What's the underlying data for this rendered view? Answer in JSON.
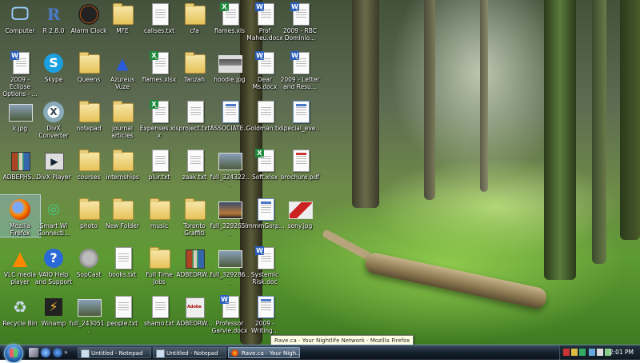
{
  "desktop": {
    "columns": [
      [
        {
          "label": "Computer",
          "icon": "computer-icon"
        },
        {
          "label": "2009 - Eclipse Options - ...",
          "icon": "word-doc-icon"
        },
        {
          "label": "k.jpg",
          "icon": "image-icon"
        },
        {
          "label": "ADBEPHS...",
          "icon": "archive-icon"
        },
        {
          "label": "Mozilla Firefox",
          "icon": "firefox-icon",
          "selected": true
        },
        {
          "label": "VLC media player",
          "icon": "vlc-icon"
        },
        {
          "label": "Recycle Bin",
          "icon": "recycle-bin-icon"
        }
      ],
      [
        {
          "label": "R 2.8.0",
          "icon": "r-icon"
        },
        {
          "label": "Skype",
          "icon": "skype-icon"
        },
        {
          "label": "DivX Converter",
          "icon": "divx-converter-icon"
        },
        {
          "label": "DivX Player",
          "icon": "divx-player-icon"
        },
        {
          "label": "Smart Wi Connecti...",
          "icon": "wifi-icon"
        },
        {
          "label": "VAIO Help and Support",
          "icon": "help-icon"
        },
        {
          "label": "Winamp",
          "icon": "winamp-icon"
        }
      ],
      [
        {
          "label": "Alarm Clock",
          "icon": "clock-icon"
        },
        {
          "label": "Queens",
          "icon": "folder-icon"
        },
        {
          "label": "notepad",
          "icon": "folder-icon"
        },
        {
          "label": "courses",
          "icon": "folder-icon"
        },
        {
          "label": "photo",
          "icon": "folder-icon"
        },
        {
          "label": "SopCast",
          "icon": "sopcast-icon"
        },
        {
          "label": "full_243051...",
          "icon": "image-icon"
        }
      ],
      [
        {
          "label": "MFE",
          "icon": "folder-icon"
        },
        {
          "label": "Azureus Vuze",
          "icon": "vuze-icon"
        },
        {
          "label": "journal articles",
          "icon": "folder-icon"
        },
        {
          "label": "internships",
          "icon": "folder-icon"
        },
        {
          "label": "New Folder",
          "icon": "folder-icon"
        },
        {
          "label": "books.txt",
          "icon": "text-file-icon"
        },
        {
          "label": "people.txt",
          "icon": "text-file-icon"
        }
      ],
      [
        {
          "label": "callses.txt",
          "icon": "text-file-icon"
        },
        {
          "label": "flames.xlsx",
          "icon": "excel-icon"
        },
        {
          "label": "Expenses.xlsx",
          "icon": "excel-icon"
        },
        {
          "label": "plur.txt",
          "icon": "text-file-icon"
        },
        {
          "label": "music",
          "icon": "folder-icon"
        },
        {
          "label": "Full Time Jobs",
          "icon": "folder-icon"
        },
        {
          "label": "shamo.txt",
          "icon": "text-file-icon"
        }
      ],
      [
        {
          "label": "cfa",
          "icon": "folder-icon"
        },
        {
          "label": "Tanzah",
          "icon": "folder-icon"
        },
        {
          "label": "project.txt",
          "icon": "text-file-icon"
        },
        {
          "label": "zaak.txt",
          "icon": "text-file-icon"
        },
        {
          "label": "Toronto Graffiti",
          "icon": "folder-icon"
        },
        {
          "label": "ADBEDRW...",
          "icon": "archive-icon"
        },
        {
          "label": "ADBEDRW...",
          "icon": "adobe-icon"
        }
      ],
      [
        {
          "label": "flames.xls",
          "icon": "excel-icon"
        },
        {
          "label": "hoodie.jpg",
          "icon": "image-icon"
        },
        {
          "label": "ASSOCIATE...",
          "icon": "html-file-icon"
        },
        {
          "label": "full_324322...",
          "icon": "image-icon"
        },
        {
          "label": "full_329265...",
          "icon": "image-icon"
        },
        {
          "label": "full_329286...",
          "icon": "image-icon"
        },
        {
          "label": "Professor Garvie.docx",
          "icon": "word-doc-icon"
        }
      ],
      [
        {
          "label": "Prof Maheu.docx",
          "icon": "word-doc-icon"
        },
        {
          "label": "Dear Ms.docx",
          "icon": "word-doc-icon"
        },
        {
          "label": "Goldman.txt",
          "icon": "text-file-icon"
        },
        {
          "label": "Soft.xlsx",
          "icon": "excel-icon"
        },
        {
          "label": "ImmmGorp...",
          "icon": "html-file-icon"
        },
        {
          "label": "Systemic Risk.doc",
          "icon": "word-doc-icon"
        },
        {
          "label": "2009 - Writing...",
          "icon": "html-file-icon"
        }
      ],
      [
        {
          "label": "2009 - RBC Dominio...",
          "icon": "word-doc-icon"
        },
        {
          "label": "2009 - Letter and Resu...",
          "icon": "word-doc-icon"
        },
        {
          "label": "special_eve...",
          "icon": "html-file-icon"
        },
        {
          "label": "brochure.pdf",
          "icon": "pdf-icon"
        },
        {
          "label": "sony.jpg",
          "icon": "image-icon"
        }
      ]
    ]
  },
  "taskbar": {
    "buttons": [
      {
        "label": "Untitled - Notepad",
        "active": false
      },
      {
        "label": "Untitled - Notepad",
        "active": false
      },
      {
        "label": "Rave.ca - Your Nigh...",
        "active": true
      }
    ],
    "clock": "2:01 PM"
  },
  "tooltip": "Rave.ca - Your Nightlife Network - Mozilla Firefox"
}
